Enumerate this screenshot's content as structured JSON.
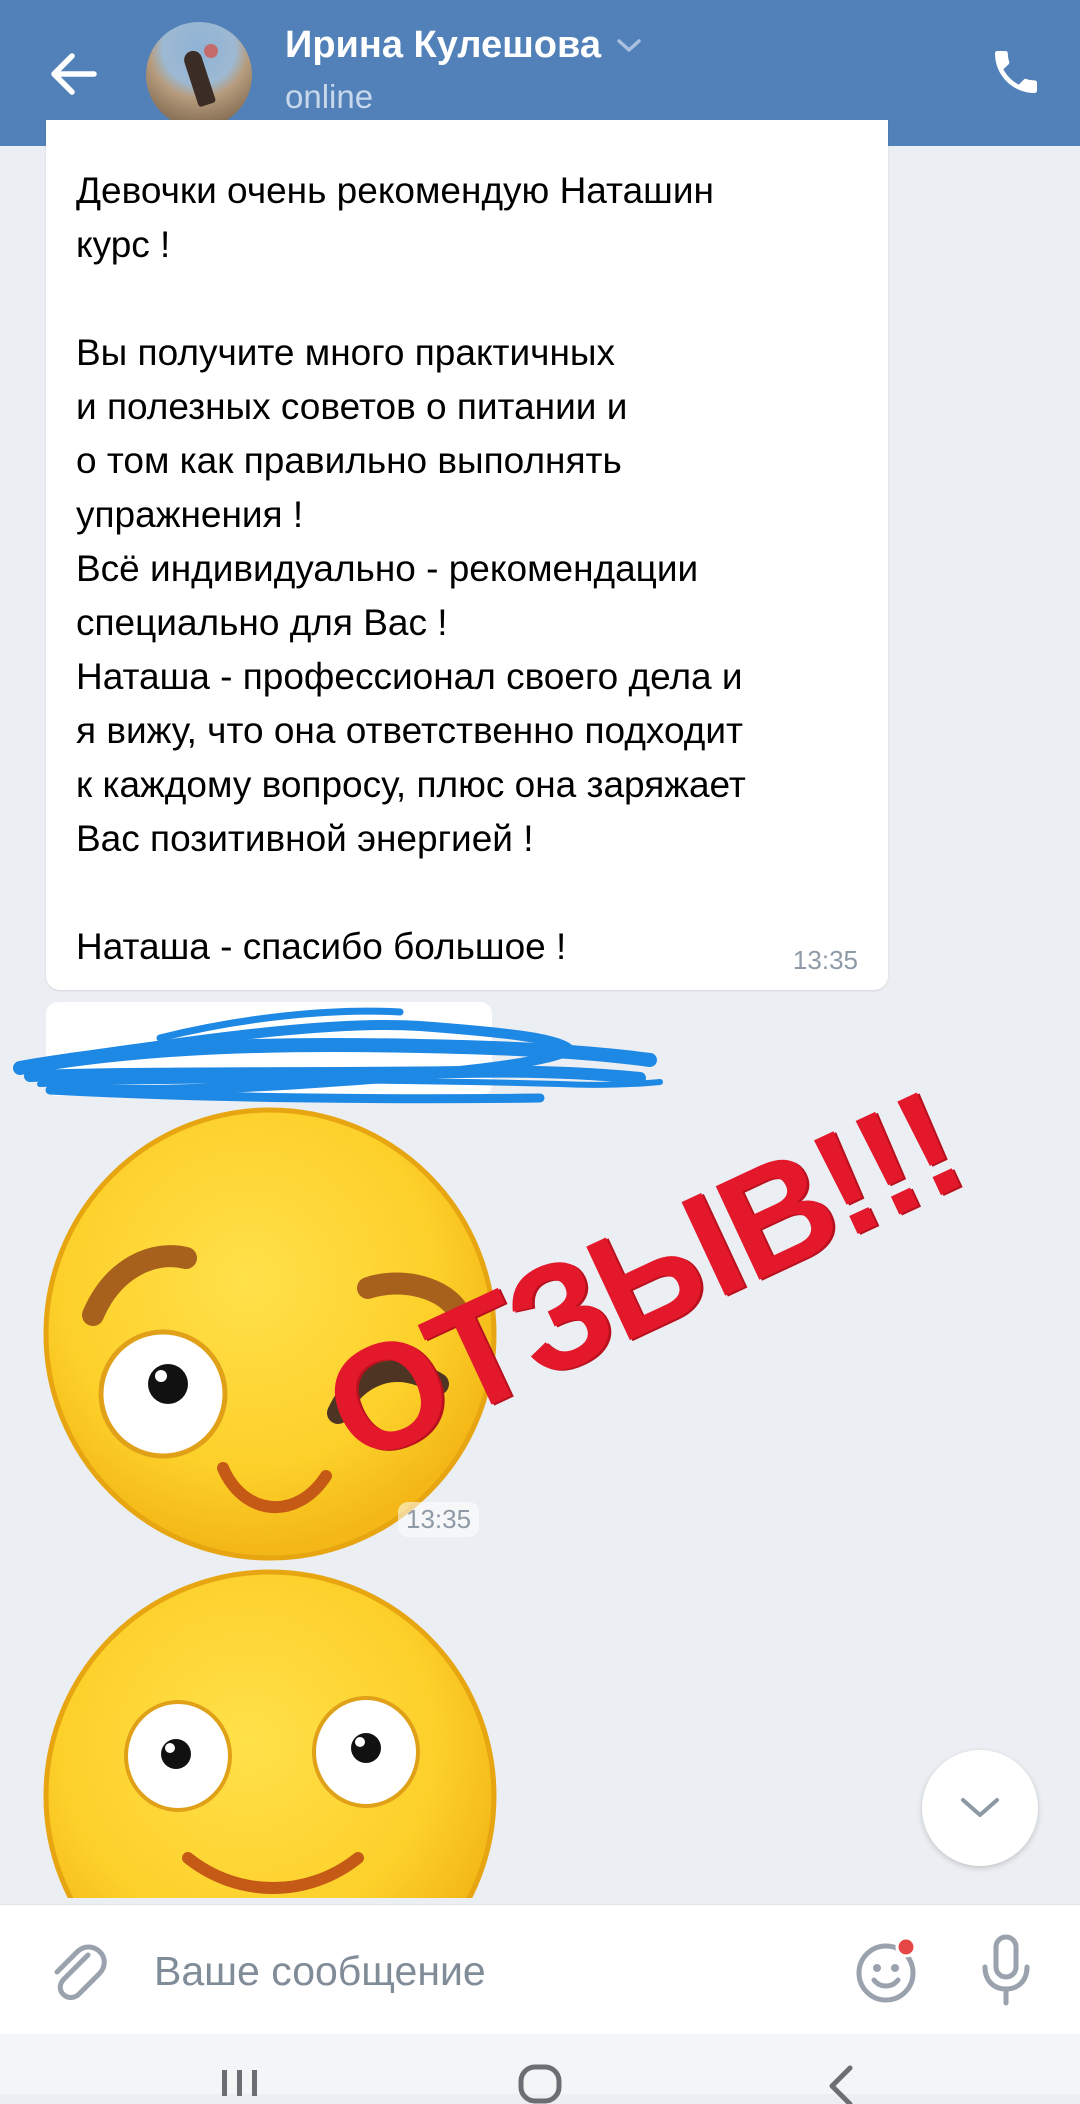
{
  "header": {
    "contact_name": "Ирина Кулешова",
    "status": "online",
    "icons": {
      "back": "arrow-left-icon",
      "dropdown": "chevron-down-icon",
      "call": "phone-icon"
    }
  },
  "messages": [
    {
      "type": "text",
      "text": "Девочки очень рекомендую Наташин\nкурс !\n\nВы получите много практичных\nи полезных советов о питании и\nо том как правильно выполнять\nупражнения !\nВсё индивидуально - рекомендации\nспециально для Вас !\nНаташа - профессионал своего дела и\nя вижу, что она ответственно подходит\nк каждому вопросу, плюс она заряжает\nВас позитивной энергией !\n\nНаташа - спасибо большое !",
      "time": "13:35"
    },
    {
      "type": "redacted-text"
    },
    {
      "type": "sticker",
      "sticker": "wink-emoji",
      "time": "13:35"
    },
    {
      "type": "sticker",
      "sticker": "smile-emoji"
    }
  ],
  "overlay": {
    "text": "ОТЗЫВ!!!",
    "color": "#e3182b"
  },
  "composer": {
    "placeholder": "Ваше сообщение",
    "icons": {
      "attach": "paperclip-icon",
      "emoji": "emoji-icon",
      "mic": "microphone-icon"
    }
  },
  "colors": {
    "header_bg": "#5181b8",
    "chat_bg": "#ebeef2",
    "accent_badge": "#e64646"
  }
}
